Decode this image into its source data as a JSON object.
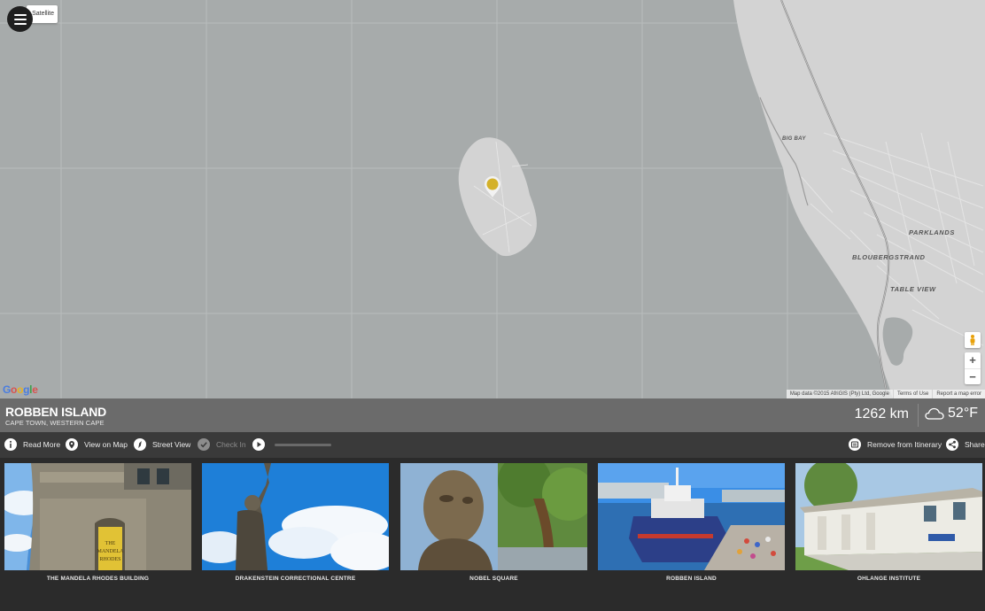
{
  "map": {
    "map_type_label": "Satellite",
    "labels": {
      "big_bay": "BIG BAY",
      "parklands": "PARKLANDS",
      "bloubergstrand": "BLOUBERGSTRAND",
      "table_view": "TABLE VIEW"
    },
    "zoom_in": "+",
    "zoom_out": "−",
    "attribution": {
      "data": "Map data ©2015 AfriGIS (Pty) Ltd, Google",
      "terms": "Terms of Use",
      "report": "Report a map error"
    },
    "marker_color": "#d4b12a"
  },
  "place": {
    "title": "ROBBEN ISLAND",
    "subtitle": "CAPE TOWN, WESTERN CAPE",
    "distance": "1262 km",
    "temperature": "52°F",
    "weather_icon": "cloud-icon"
  },
  "actions": {
    "read_more": "Read More",
    "view_on_map": "View on Map",
    "street_view": "Street View",
    "check_in": "Check In",
    "remove_itinerary": "Remove from Itinerary",
    "share": "Share",
    "audio_progress": 0
  },
  "gallery": [
    {
      "title": "THE MANDELA RHODES BUILDING"
    },
    {
      "title": "DRAKENSTEIN CORRECTIONAL CENTRE"
    },
    {
      "title": "NOBEL SQUARE"
    },
    {
      "title": "ROBBEN ISLAND"
    },
    {
      "title": "OHLANGE INSTITUTE"
    }
  ],
  "gallery_sign_text": [
    "THE",
    "MANDELA",
    "RHODES"
  ]
}
